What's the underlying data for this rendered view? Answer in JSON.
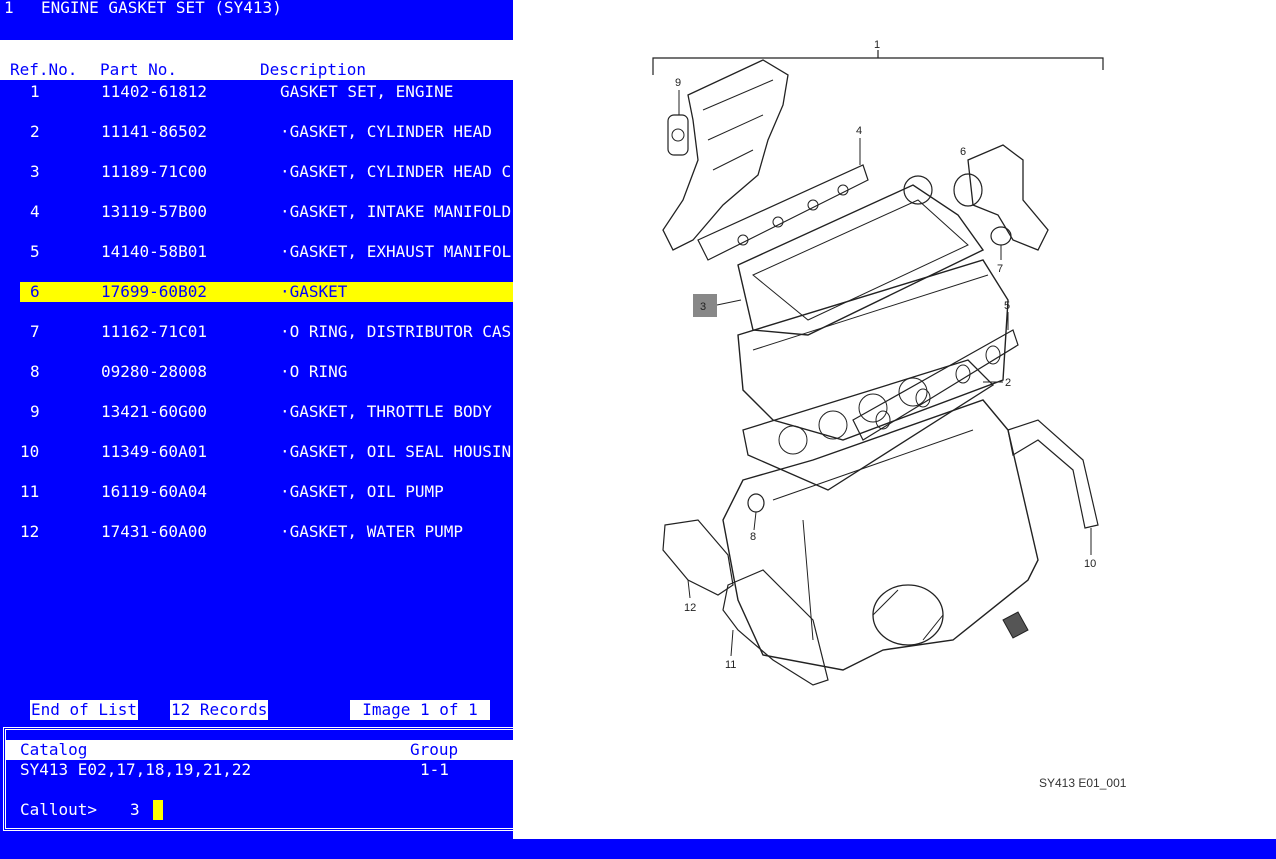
{
  "title": {
    "index": "1",
    "name": "ENGINE GASKET SET (SY413)"
  },
  "list_header": {
    "ref": "Ref.No.",
    "part": "Part No.",
    "desc": "Description"
  },
  "rows": [
    {
      "ref": "1",
      "part": "11402-61812",
      "desc": "GASKET SET, ENGINE"
    },
    {
      "ref": "2",
      "part": "11141-86502",
      "desc": "·GASKET, CYLINDER HEAD"
    },
    {
      "ref": "3",
      "part": "11189-71C00",
      "desc": "·GASKET, CYLINDER HEAD C"
    },
    {
      "ref": "4",
      "part": "13119-57B00",
      "desc": "·GASKET, INTAKE MANIFOLD"
    },
    {
      "ref": "5",
      "part": "14140-58B01",
      "desc": "·GASKET, EXHAUST MANIFOL"
    },
    {
      "ref": "6",
      "part": "17699-60B02",
      "desc": "·GASKET"
    },
    {
      "ref": "7",
      "part": "11162-71C01",
      "desc": "·O RING, DISTRIBUTOR CAS"
    },
    {
      "ref": "8",
      "part": "09280-28008",
      "desc": "·O RING"
    },
    {
      "ref": "9",
      "part": "13421-60G00",
      "desc": "·GASKET, THROTTLE BODY"
    },
    {
      "ref": "10",
      "part": "11349-60A01",
      "desc": "·GASKET, OIL SEAL HOUSIN"
    },
    {
      "ref": "11",
      "part": "16119-60A04",
      "desc": "·GASKET, OIL PUMP"
    },
    {
      "ref": "12",
      "part": "17431-60A00",
      "desc": "·GASKET, WATER PUMP"
    }
  ],
  "selected_ref": "6",
  "status": {
    "end": "End of List",
    "records": "12 Records",
    "image": "Image 1 of 1"
  },
  "catalog": {
    "label": "Catalog",
    "group_label": "Group",
    "value": "SY413 E02,17,18,19,21,22",
    "group_value": "1-1"
  },
  "callout": {
    "label": "Callout>",
    "value": "3"
  },
  "diagram": {
    "callouts": [
      "1",
      "2",
      "4",
      "5",
      "6",
      "7",
      "8",
      "9",
      "10",
      "11",
      "12"
    ],
    "highlight_callout": "3",
    "caption": "SY413 E01_001"
  },
  "colors": {
    "screen": "#0000ff",
    "text": "#ffffff",
    "highlight": "#ffff00"
  }
}
